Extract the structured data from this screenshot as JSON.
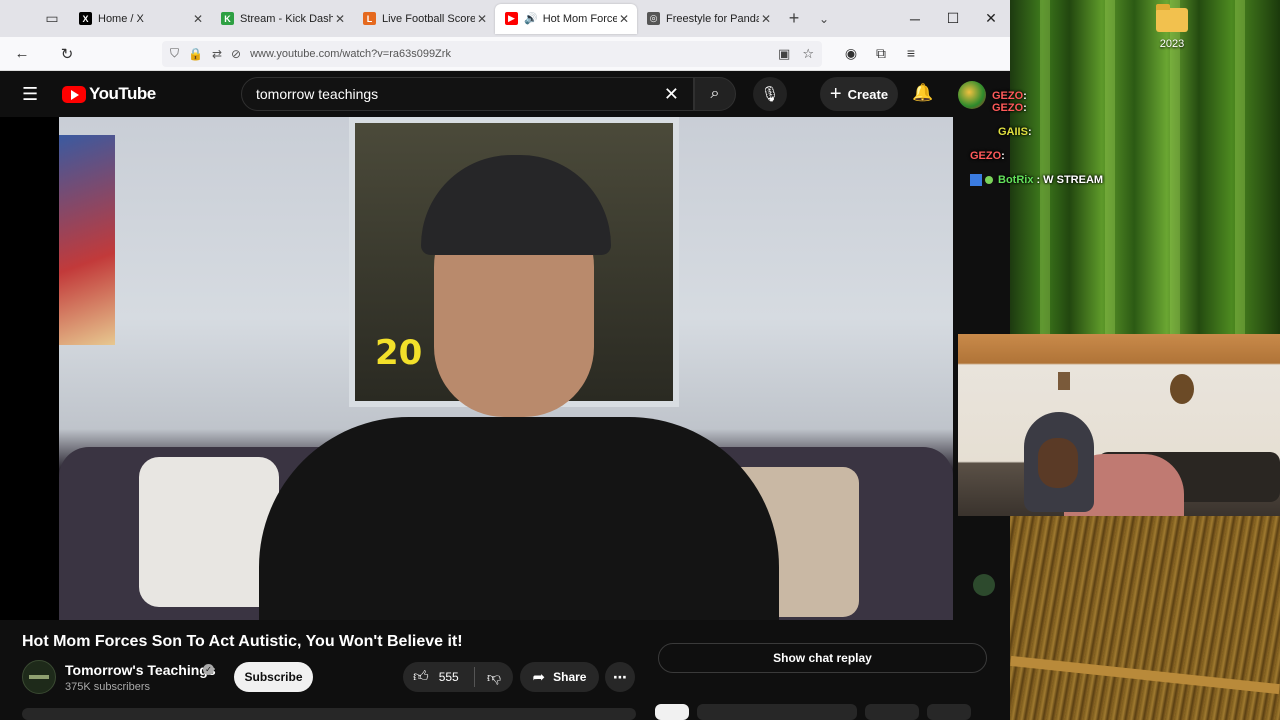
{
  "desktop": {
    "icon_label": "2023"
  },
  "browser": {
    "tabs": [
      {
        "label": "Home / X",
        "favicon": "x-logo-icon",
        "active": false
      },
      {
        "label": "Stream - Kick Dashbo",
        "favicon": "kick-logo-icon",
        "active": false
      },
      {
        "label": "Live Football Scores, F",
        "favicon": "livescore-icon",
        "active": false
      },
      {
        "label": "Hot Mom Forces",
        "favicon": "youtube-icon",
        "active": true,
        "audio": true
      },
      {
        "label": "Freestyle for Panda",
        "favicon": "openai-icon",
        "active": false
      }
    ],
    "url": "www.youtube.com/watch?v=ra63s099Zrk"
  },
  "youtube": {
    "logo_text": "YouTube",
    "search_value": "tomorrow teachings",
    "create_label": "Create",
    "video_title": "Hot Mom Forces Son To Act Autistic, You Won't Believe it!",
    "channel_name": "Tomorrow's Teachings",
    "subscribers": "375K subscribers",
    "subscribe_label": "Subscribe",
    "likes": "555",
    "share_label": "Share",
    "chat_replay_label": "Show chat replay",
    "poster_text": "20"
  },
  "stream_chat": {
    "messages": [
      {
        "user": "GEZO",
        "text": ":"
      },
      {
        "user": "GEZO",
        "text": ":"
      },
      {
        "user": "GAIIS",
        "text": ":"
      },
      {
        "user": "GEZO",
        "text": ":"
      }
    ],
    "bot_user": "BotRix",
    "bot_text": ": W STREAM"
  },
  "colors": {
    "yt_bg": "#0f0f0f",
    "yt_red": "#ff0000",
    "chat_green": "#62e05a"
  }
}
